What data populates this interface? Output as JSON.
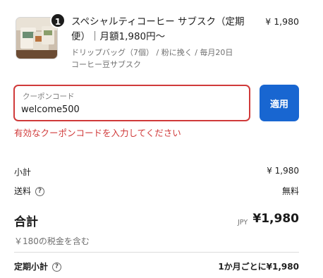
{
  "product": {
    "quantity": "1",
    "title": "スペシャルティコーヒー サブスク（定期便）｜月額1,980円〜",
    "variant": "ドリップバッグ（7個） / 粉に挽く / 毎月20日",
    "variant2": "コーヒー豆サブスク",
    "price": "¥ 1,980"
  },
  "coupon": {
    "label": "クーポンコード",
    "value": "welcome500",
    "apply_label": "適用",
    "error": "有効なクーポンコードを入力してください"
  },
  "summary": {
    "subtotal_label": "小計",
    "subtotal_value": "¥ 1,980",
    "shipping_label": "送料",
    "shipping_value": "無料",
    "total_label": "合計",
    "total_currency": "JPY",
    "total_value": "¥1,980",
    "tax_note": "￥180の税金を含む",
    "recurring_label": "定期小計",
    "recurring_value": "1か月ごとに¥1,980",
    "help_glyph": "?"
  },
  "colors": {
    "error": "#d03a3a",
    "button": "#1866d1"
  }
}
